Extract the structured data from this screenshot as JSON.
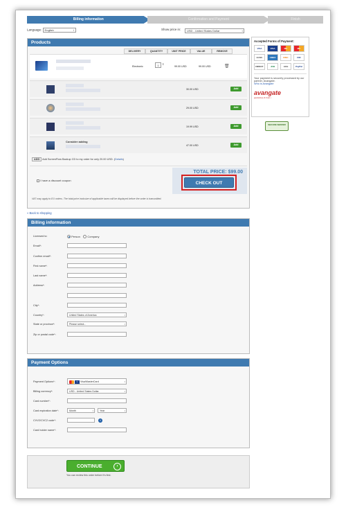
{
  "steps": [
    "Billing information",
    "Confirmation and Payment",
    "Finish"
  ],
  "language": {
    "label": "Language:",
    "value": "English"
  },
  "show_price": {
    "label": "Show price in:",
    "value": "USD - United States Dollar"
  },
  "products": {
    "title": "Products",
    "columns": [
      "DELIVERY",
      "QUANTITY",
      "UNIT PRICE",
      "VALUE",
      "REMOVE"
    ],
    "main": {
      "delivery": "Electronic",
      "quantity": "1",
      "unit_price": "99.00 USD",
      "value": "99.00 USD"
    },
    "upsells": [
      {
        "title": "",
        "price": "30.00 USD",
        "add": "Add"
      },
      {
        "title": "",
        "price": "29.00 USD",
        "add": "Add"
      },
      {
        "title": "",
        "price": "19.99 USD",
        "add": "Add"
      },
      {
        "title": "Consider adding",
        "price": "47.00 USD",
        "add": "Add"
      }
    ],
    "backup": {
      "add": "ADD",
      "text": "Add ScreenFlow Backup CD to my order for only 20.00 USD. (",
      "details": "Details",
      "close": ")"
    },
    "discount_label": "I have a discount coupon",
    "total": "TOTAL PRICE: $99.00",
    "checkout": "CHECK OUT",
    "vat_note": "VAT may apply to EU orders. The total price inclusive of applicable taxes will be displayed before the order is transmitted."
  },
  "back_link": "« Back to shopping",
  "billing": {
    "title": "Billing information",
    "licensed_label": "Licensed to:",
    "person": "Person",
    "company": "Company",
    "fields": [
      "Email*:",
      "Confirm email*:",
      "First name*:",
      "Last name*:",
      "Address*:",
      "",
      "City*:",
      "Country*:",
      "State or province*:",
      "Zip or postal code*:"
    ],
    "country_value": "United States of America",
    "state_value": "Please select..."
  },
  "payment": {
    "title": "Payment Options",
    "options_label": "Payment Options*:",
    "options_value": "Visa/MasterCard",
    "currency_label": "Billing currency*:",
    "currency_value": "USD - United States Dollar",
    "card_number_label": "Card number*:",
    "expiration_label": "Card expiration date*:",
    "month": "Month",
    "year": "Year",
    "cvv_label": "CVV2/CVC2 code*:",
    "holder_label": "Card holder name*:"
  },
  "continue": {
    "label": "CONTINUE",
    "note": "You can review this order before it's first."
  },
  "sidebar": {
    "title": "Accepted Forms of Payment:",
    "cards": [
      "VISA",
      "VISA",
      "MC",
      "MC",
      "BANK",
      "AMEX",
      "DISC",
      "DIN",
      "DIRECT",
      "JCB",
      "ACH",
      "PayPal"
    ],
    "note": "Your payment is securely processed by our partner, Avangate.",
    "who_link": "Who is Avangate",
    "brand": "avangate",
    "brand_sub": "guarantee & trust •",
    "seal": "SECURE SERVER"
  },
  "colors": {
    "accent": "#3f7ab0",
    "add": "#3e9a2e",
    "checkout_border": "#d42020",
    "continue": "#4aae2e"
  }
}
